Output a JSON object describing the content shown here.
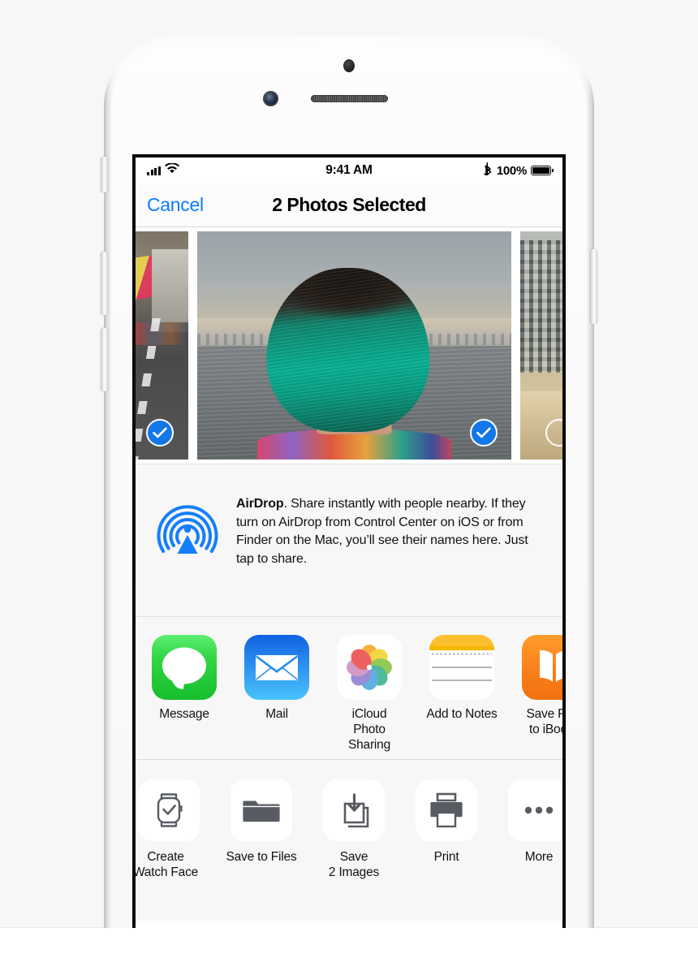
{
  "device": {
    "name": "iPhone",
    "body_color": "#fbfbfb",
    "bezel_color": "#0a0a0a"
  },
  "status_bar": {
    "carrier_signal_icon": "signal-bars-icon",
    "wifi_icon": "wifi-icon",
    "time": "9:41 AM",
    "bluetooth_icon": "bluetooth-icon",
    "battery_percent": "100%",
    "battery_icon": "battery-full-icon"
  },
  "nav_bar": {
    "cancel_label": "Cancel",
    "title": "2 Photos Selected"
  },
  "photo_strip": {
    "photos": [
      {
        "name": "street-scene-photo",
        "selected": true,
        "alt": "City street with red and yellow awning"
      },
      {
        "name": "portrait-photo",
        "selected": true,
        "alt": "Person with teal hair looking at the harbour"
      },
      {
        "name": "buildings-photo",
        "selected": false,
        "alt": "Apartment buildings by a seawall"
      }
    ],
    "selected_badge_color": "#1278e8",
    "check_glyph": "checkmark-icon"
  },
  "airdrop": {
    "icon": "airdrop-icon",
    "icon_color": "#147efb",
    "title": "AirDrop",
    "body": ". Share instantly with people nearby. If they turn on AirDrop from Control Center on iOS or from Finder on the Mac, you’ll see their names here. Just tap to share."
  },
  "apps": [
    {
      "name": "share-app-message",
      "label": "Message",
      "icon": "messages-icon"
    },
    {
      "name": "share-app-mail",
      "label": "Mail",
      "icon": "mail-icon"
    },
    {
      "name": "share-app-icloud-photo-sharing",
      "label": "iCloud\nPhoto Sharing",
      "icon": "photos-icon"
    },
    {
      "name": "share-app-add-to-notes",
      "label": "Add to Notes",
      "icon": "notes-icon"
    },
    {
      "name": "share-app-save-pdf-ibooks",
      "label": "Save PDF\nto iBooks",
      "icon": "ibooks-icon"
    }
  ],
  "actions": [
    {
      "name": "action-create-watch-face",
      "label": "Create\nWatch Face",
      "icon": "apple-watch-icon"
    },
    {
      "name": "action-save-to-files",
      "label": "Save to Files",
      "icon": "folder-icon"
    },
    {
      "name": "action-save-images",
      "label": "Save\n2 Images",
      "icon": "save-image-icon"
    },
    {
      "name": "action-print",
      "label": "Print",
      "icon": "printer-icon"
    },
    {
      "name": "action-more",
      "label": "More",
      "icon": "ellipsis-icon"
    }
  ],
  "colors": {
    "tint_blue": "#0a7cff",
    "airdrop_blue": "#147efb",
    "sheet_background": "#f7f7f7",
    "glyph_gray": "#595b63"
  }
}
